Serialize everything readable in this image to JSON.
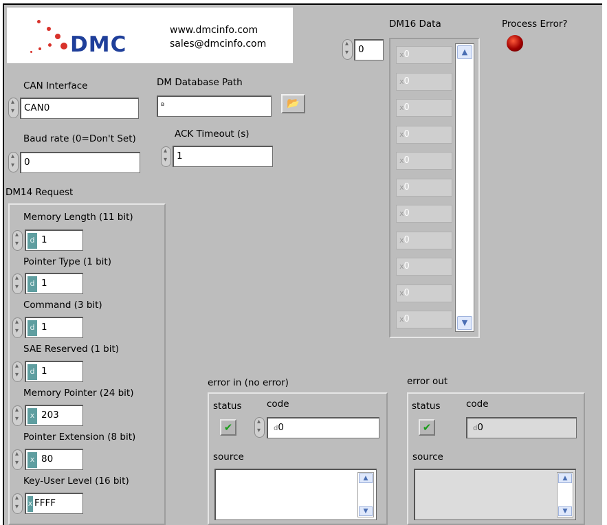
{
  "logo": {
    "brand": "DMC",
    "website": "www.dmcinfo.com",
    "email": "sales@dmcinfo.com"
  },
  "can_interface": {
    "label": "CAN Interface",
    "value": "CAN0"
  },
  "db_path": {
    "label": "DM Database Path",
    "value": "",
    "prefix": "ᴮ"
  },
  "baud_rate": {
    "label": "Baud rate (0=Don't Set)",
    "value": "0"
  },
  "ack_timeout": {
    "label": "ACK Timeout (s)",
    "value": "1"
  },
  "dm14": {
    "title": "DM14 Request",
    "fields": [
      {
        "label": "Memory Length (11 bit)",
        "radix": "d",
        "value": "1"
      },
      {
        "label": "Pointer Type (1 bit)",
        "radix": "d",
        "value": "1"
      },
      {
        "label": "Command (3 bit)",
        "radix": "d",
        "value": "1"
      },
      {
        "label": "SAE Reserved (1 bit)",
        "radix": "d",
        "value": "1"
      },
      {
        "label": "Memory Pointer (24 bit)",
        "radix": "x",
        "value": "203"
      },
      {
        "label": "Pointer Extension (8 bit)",
        "radix": "x",
        "value": "80"
      },
      {
        "label": "Key-User Level (16 bit)",
        "radix": "x",
        "value": "FFFF"
      }
    ]
  },
  "dm16": {
    "title": "DM16 Data",
    "index": "0",
    "items": [
      "0",
      "0",
      "0",
      "0",
      "0",
      "0",
      "0",
      "0",
      "0",
      "0",
      "0"
    ],
    "radix": "x"
  },
  "process_error": {
    "label": "Process Error?"
  },
  "error_in": {
    "title": "error in (no error)",
    "status_label": "status",
    "code_label": "code",
    "code_value": "0",
    "code_radix": "d",
    "source_label": "source",
    "source_value": ""
  },
  "error_out": {
    "title": "error out",
    "status_label": "status",
    "code_label": "code",
    "code_value": "0",
    "code_radix": "d",
    "source_label": "source",
    "source_value": ""
  },
  "colors": {
    "panel": "#bdbdbd",
    "brand_blue": "#1f3f9a",
    "brand_red": "#d8322b",
    "led_red": "#a00000",
    "check_green": "#1a9d1a"
  }
}
